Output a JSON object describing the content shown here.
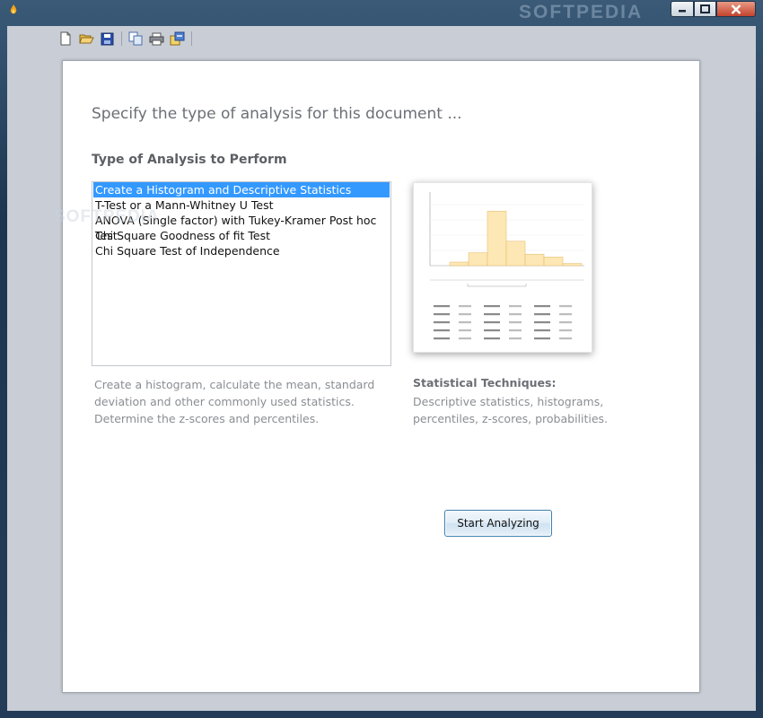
{
  "window": {
    "watermark": "SOFTPEDIA",
    "side_watermark": "SOFTPEDIA"
  },
  "toolbar": {
    "buttons": [
      "new-document-icon",
      "open-folder-icon",
      "save-icon",
      "copy-icon",
      "print-icon",
      "export-icon"
    ]
  },
  "main": {
    "heading": "Specify the type of analysis for this document ...",
    "section_title": "Type of Analysis to Perform",
    "analysis_options": [
      "Create a Histogram and Descriptive Statistics",
      "T-Test or a Mann-Whitney U Test",
      "ANOVA (Single factor) with Tukey-Kramer Post hoc Test",
      "Chi Square Goodness of fit Test",
      "Chi Square Test of Independence"
    ],
    "selected_index": 0,
    "description": "Create a histogram, calculate the mean, standard deviation and other commonly used statistics. Determine the z-scores and percentiles.",
    "techniques_title": "Statistical Techniques:",
    "techniques_text": "Descriptive statistics, histograms, percentiles, z-scores, probabilities.",
    "start_button": "Start Analyzing"
  },
  "colors": {
    "selection": "#3399ff",
    "bar_fill": "#fde7b4",
    "button_border": "#3c7fb1"
  }
}
